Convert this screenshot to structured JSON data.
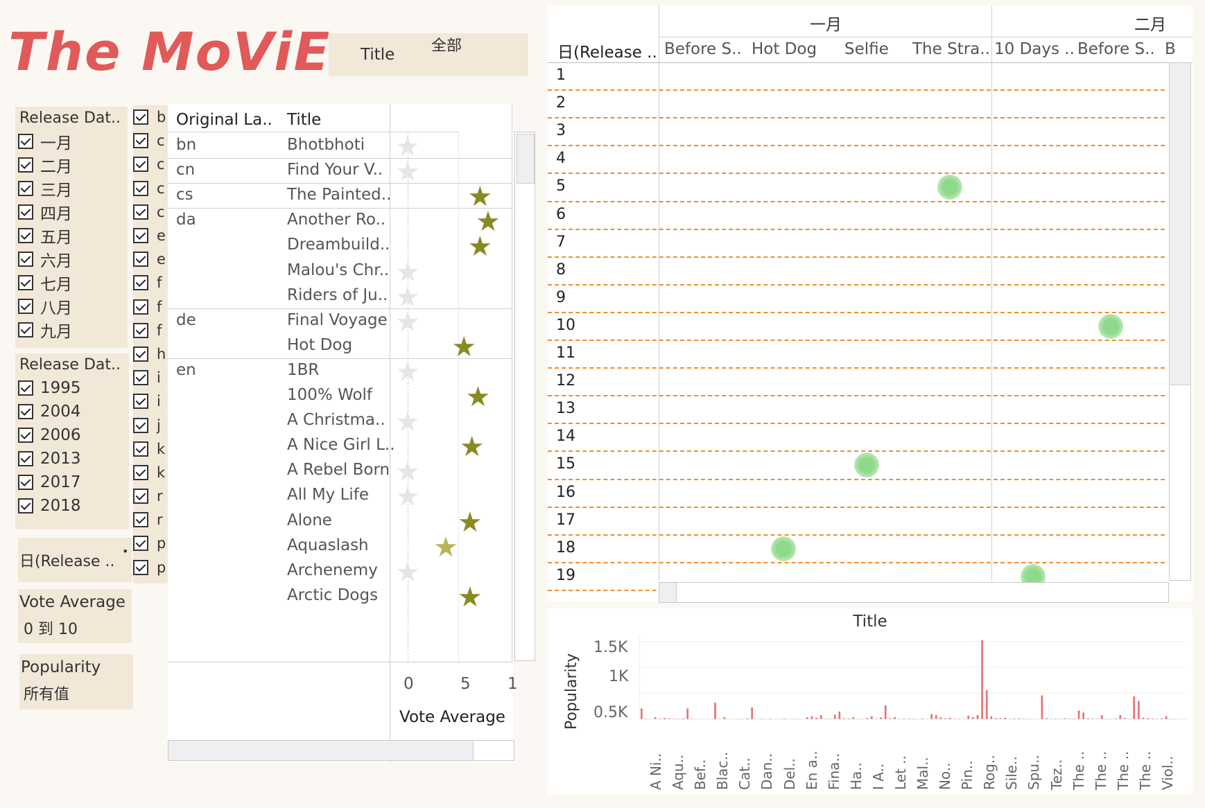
{
  "app": {
    "title": "The MoViEs .."
  },
  "title_filter": {
    "label": "Title",
    "value": "全部"
  },
  "release_month_filter": {
    "header": "Release Dat..",
    "items": [
      "一月",
      "二月",
      "三月",
      "四月",
      "五月",
      "六月",
      "七月",
      "八月",
      "九月"
    ]
  },
  "release_year_filter": {
    "header": "Release Dat..",
    "items": [
      "1995",
      "2004",
      "2006",
      "2013",
      "2017",
      "2018"
    ]
  },
  "day_filter": {
    "label": "日(Release .."
  },
  "vote_filter": {
    "label": "Vote Average",
    "value": "0 到 10"
  },
  "popularity_filter": {
    "label": "Popularity",
    "value": "所有值"
  },
  "language_checks": [
    "b",
    "c",
    "c",
    "c",
    "c",
    "e",
    "e",
    "f",
    "f",
    "f",
    "h",
    "i",
    "i",
    "j",
    "k",
    "k",
    "r",
    "r",
    "p",
    "p"
  ],
  "table": {
    "col_lang": "Original La..",
    "col_title": "Title",
    "x_axis_label": "Vote Average",
    "x_ticks": [
      "0",
      "5",
      "1"
    ],
    "groups": [
      {
        "lang": "bn",
        "rows": [
          {
            "title": "Bhotbhoti",
            "vote": 0
          }
        ]
      },
      {
        "lang": "cn",
        "rows": [
          {
            "title": "Find Your V..",
            "vote": 0
          }
        ]
      },
      {
        "lang": "cs",
        "rows": [
          {
            "title": "The Painted..",
            "vote": 7.2
          }
        ]
      },
      {
        "lang": "da",
        "rows": [
          {
            "title": "Another Ro..",
            "vote": 8.0
          },
          {
            "title": "Dreambuild..",
            "vote": 7.2
          },
          {
            "title": "Malou's Chr..",
            "vote": 0
          },
          {
            "title": "Riders of Ju..",
            "vote": 0
          }
        ]
      },
      {
        "lang": "de",
        "rows": [
          {
            "title": "Final Voyage",
            "vote": 0
          },
          {
            "title": "Hot Dog",
            "vote": 5.6
          }
        ]
      },
      {
        "lang": "en",
        "rows": [
          {
            "title": "1BR",
            "vote": 0
          },
          {
            "title": "100% Wolf",
            "vote": 7.0
          },
          {
            "title": "A Christma..",
            "vote": 0
          },
          {
            "title": "A Nice Girl L..",
            "vote": 6.4
          },
          {
            "title": "A Rebel Born",
            "vote": 0
          },
          {
            "title": "All My Life",
            "vote": 0
          },
          {
            "title": "Alone",
            "vote": 6.2
          },
          {
            "title": "Aquaslash",
            "vote": 3.8
          },
          {
            "title": "Archenemy",
            "vote": 0
          },
          {
            "title": "Arctic Dogs",
            "vote": 6.2
          }
        ]
      }
    ]
  },
  "calendar": {
    "corner_label": "日(Release ..",
    "months": [
      "一月",
      "二月"
    ],
    "columns": [
      "Before S..",
      "Hot Dog",
      "Selfie",
      "The Stra..",
      "10 Days ..",
      "Before S..",
      "B"
    ],
    "days": [
      "1",
      "2",
      "3",
      "4",
      "5",
      "6",
      "7",
      "8",
      "9",
      "10",
      "11",
      "12",
      "13",
      "14",
      "15",
      "16",
      "17",
      "18",
      "19"
    ],
    "dots": [
      {
        "column": "The Stra..",
        "day": 5
      },
      {
        "column": "Before S..",
        "day": 10
      },
      {
        "column": "Selfie",
        "day": 15
      },
      {
        "column": "Hot Dog",
        "day": 18
      },
      {
        "column": "10 Days ..",
        "day": 19
      }
    ],
    "dot_color": "#8fd98a"
  },
  "chart_data": {
    "type": "bar",
    "title": "Title",
    "ylabel": "Popularity",
    "y_ticks": [
      "1.5K",
      "1K",
      "0.5K"
    ],
    "ylim": [
      0,
      1600
    ],
    "bar_color": "#e57373",
    "x_labels": [
      "A Ni..",
      "Aqu..",
      "Bef..",
      "Blac..",
      "Cat..",
      "Dan..",
      "Del..",
      "En a..",
      "Fina..",
      "Ha..",
      "I A..",
      "Let ..",
      "Mal..",
      "No..",
      "Pin..",
      "Rog..",
      "Sile..",
      "Spu..",
      "Tez..",
      "The ..",
      "The ..",
      "The ..",
      "The ..",
      "Viol.."
    ],
    "values": [
      210,
      12,
      8,
      40,
      15,
      25,
      18,
      10,
      12,
      15,
      210,
      10,
      5,
      8,
      5,
      8,
      320,
      10,
      40,
      5,
      8,
      10,
      5,
      15,
      230,
      8,
      10,
      5,
      12,
      6,
      5,
      15,
      5,
      8,
      10,
      5,
      40,
      60,
      30,
      80,
      12,
      10,
      90,
      150,
      20,
      15,
      40,
      10,
      8,
      25,
      60,
      10,
      35,
      270,
      20,
      40,
      10,
      15,
      12,
      10,
      5,
      15,
      8,
      100,
      80,
      40,
      20,
      30,
      10,
      12,
      8,
      70,
      40,
      80,
      1520,
      560,
      60,
      20,
      20,
      30,
      10,
      15,
      20,
      10,
      10,
      8,
      5,
      460,
      20,
      10,
      15,
      10,
      20,
      12,
      15,
      170,
      130,
      20,
      15,
      10,
      80,
      10,
      5,
      15,
      80,
      25,
      10,
      440,
      350,
      30,
      25,
      15,
      10,
      20,
      60,
      10,
      5,
      8,
      5
    ]
  }
}
